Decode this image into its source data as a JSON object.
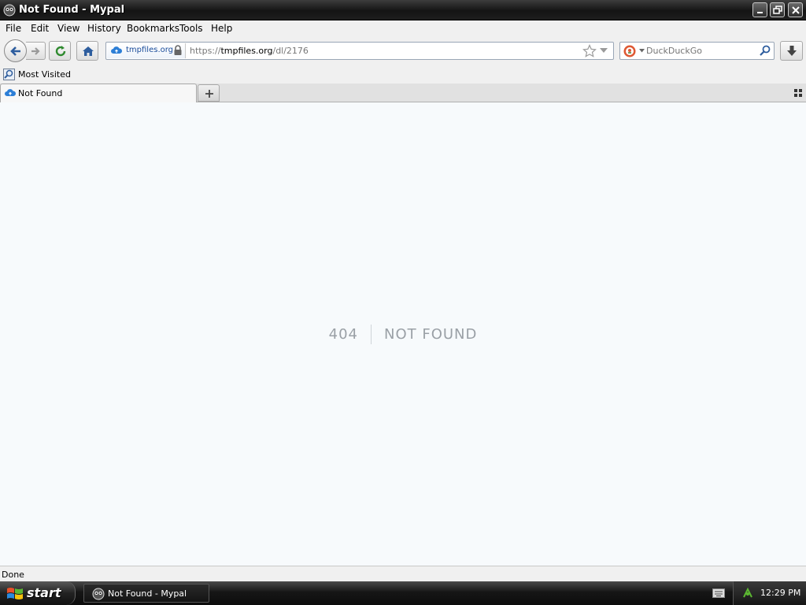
{
  "window": {
    "title": "Not Found - Mypal"
  },
  "menu": [
    "File",
    "Edit",
    "View",
    "History",
    "Bookmarks",
    "Tools",
    "Help"
  ],
  "nav": {
    "identity_host": "tmpfiles.org",
    "url_scheme": "https://",
    "url_domain": "tmpfiles.org",
    "url_path": "/dl/2176",
    "search_placeholder": "DuckDuckGo"
  },
  "bookmarks": {
    "most_visited": "Most Visited"
  },
  "tabs": [
    {
      "label": "Not Found"
    }
  ],
  "page": {
    "error_code": "404",
    "error_message": "NOT FOUND"
  },
  "status": {
    "text": "Done"
  },
  "taskbar": {
    "start_label": "start",
    "task_label": "Not Found - Mypal",
    "clock": "12:29 PM"
  },
  "colors": {
    "accent": "#1a4c9a",
    "error_text": "#9aa0a6",
    "content_bg": "#f7fafc"
  },
  "icons": [
    "app-icon",
    "minimize-icon",
    "restore-icon",
    "close-icon",
    "back-icon",
    "forward-icon",
    "reload-icon",
    "home-icon",
    "cloud-icon",
    "lock-icon",
    "star-icon",
    "dropdown-icon",
    "duckduckgo-icon",
    "search-icon",
    "download-icon",
    "most-visited-icon",
    "new-tab-icon",
    "list-all-tabs-icon",
    "windows-flag-icon",
    "keyboard-icon",
    "tray-network-icon"
  ]
}
